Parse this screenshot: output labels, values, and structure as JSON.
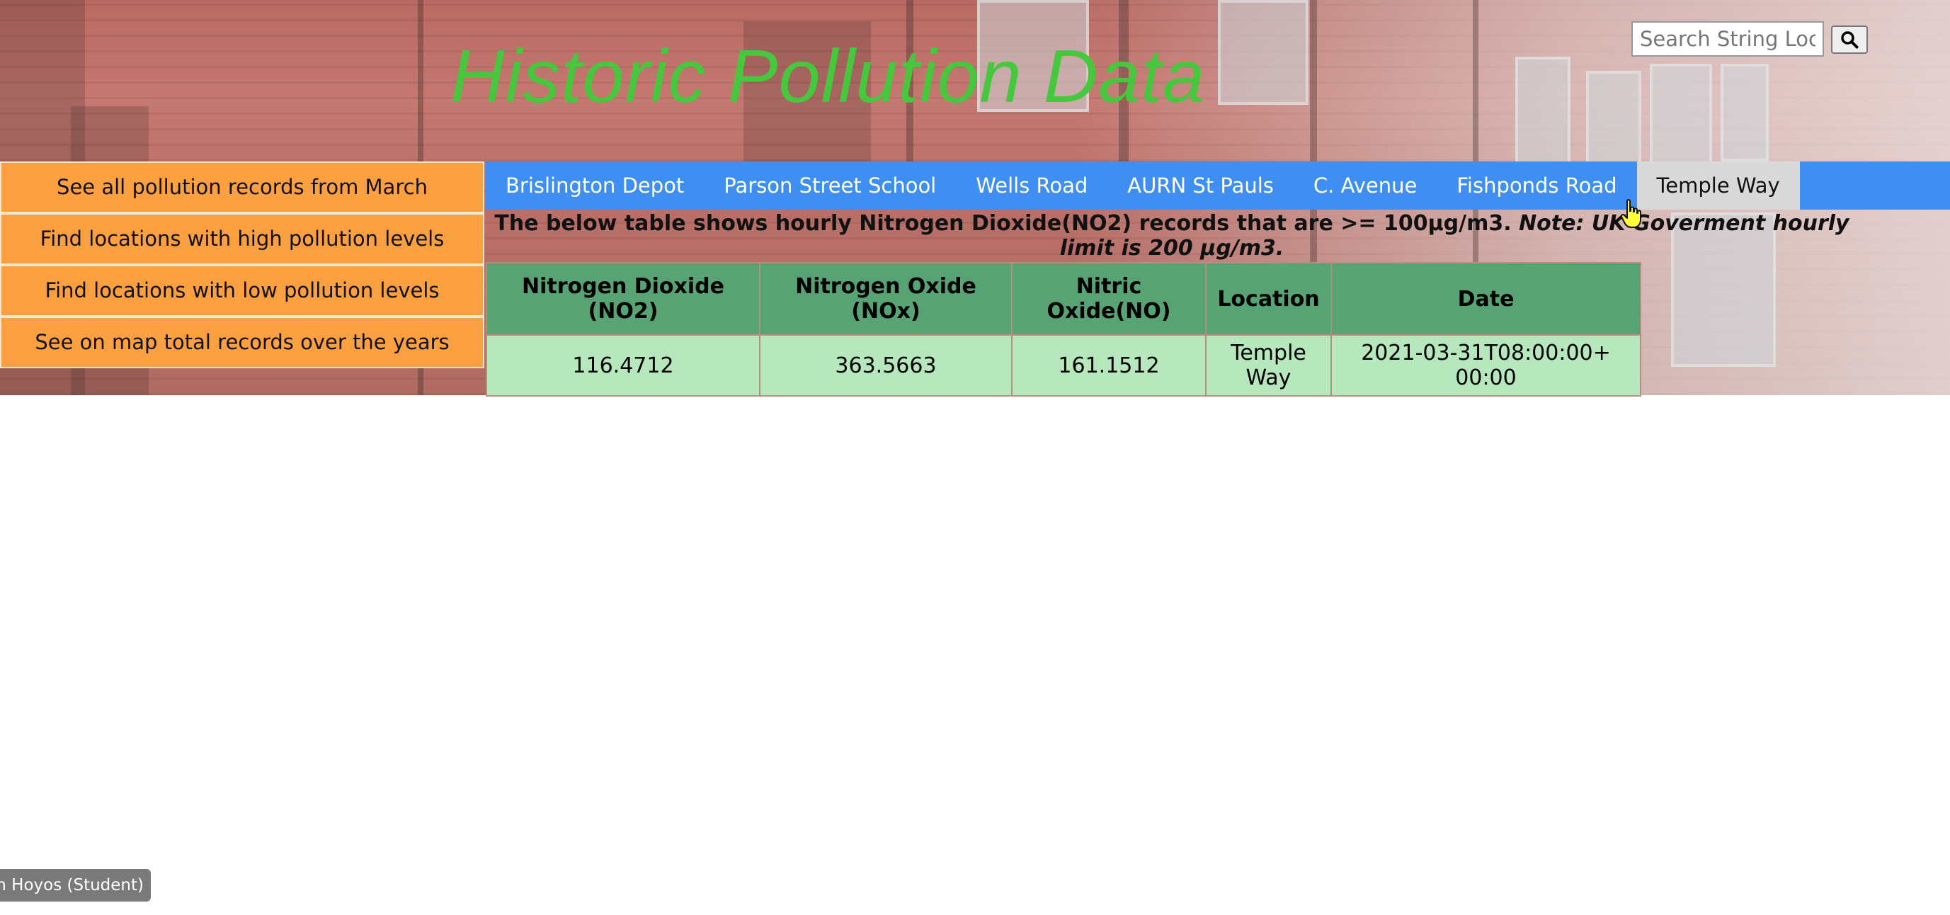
{
  "header": {
    "title": "Historic Pollution Data",
    "search_placeholder": "Search String Location",
    "search_value": "",
    "search_button_icon": "search-icon"
  },
  "side_menu": [
    {
      "label": "See all pollution records from March"
    },
    {
      "label": "Find locations with high pollution levels"
    },
    {
      "label": "Find locations with low pollution levels"
    },
    {
      "label": "See on map total records over the years"
    }
  ],
  "nav": {
    "active": "Temple Way",
    "items": [
      {
        "label": "Brislington Depot"
      },
      {
        "label": "Parson Street School"
      },
      {
        "label": "Wells Road"
      },
      {
        "label": "AURN St Pauls"
      },
      {
        "label": "C. Avenue"
      },
      {
        "label": "Fishponds Road"
      },
      {
        "label": "Temple Way"
      }
    ]
  },
  "note": {
    "text": "The below table shows hourly Nitrogen Dioxide(NO2) records that are >= 100µg/m3.",
    "emphasis": "Note: UK Goverment hourly limit is 200 µg/m3."
  },
  "table": {
    "headers": [
      "Nitrogen Dioxide (NO2)",
      "Nitrogen Oxide (NOx)",
      "Nitric Oxide(NO)",
      "Location",
      "Date"
    ],
    "rows": [
      [
        "116.4712",
        "363.5663",
        "161.1512",
        "Temple Way",
        "2021-03-31T08:00:00+00:00"
      ]
    ]
  },
  "footer": {
    "user_label": "John Hoyos (Student)"
  },
  "colors": {
    "title": "#46c83c",
    "side_menu_bg": "#fba040",
    "nav_bg": "#3f8ff2",
    "nav_active_bg": "#d9d9d9",
    "table_header_bg": "#57a373",
    "table_cell_bg": "#b7e7bd"
  }
}
